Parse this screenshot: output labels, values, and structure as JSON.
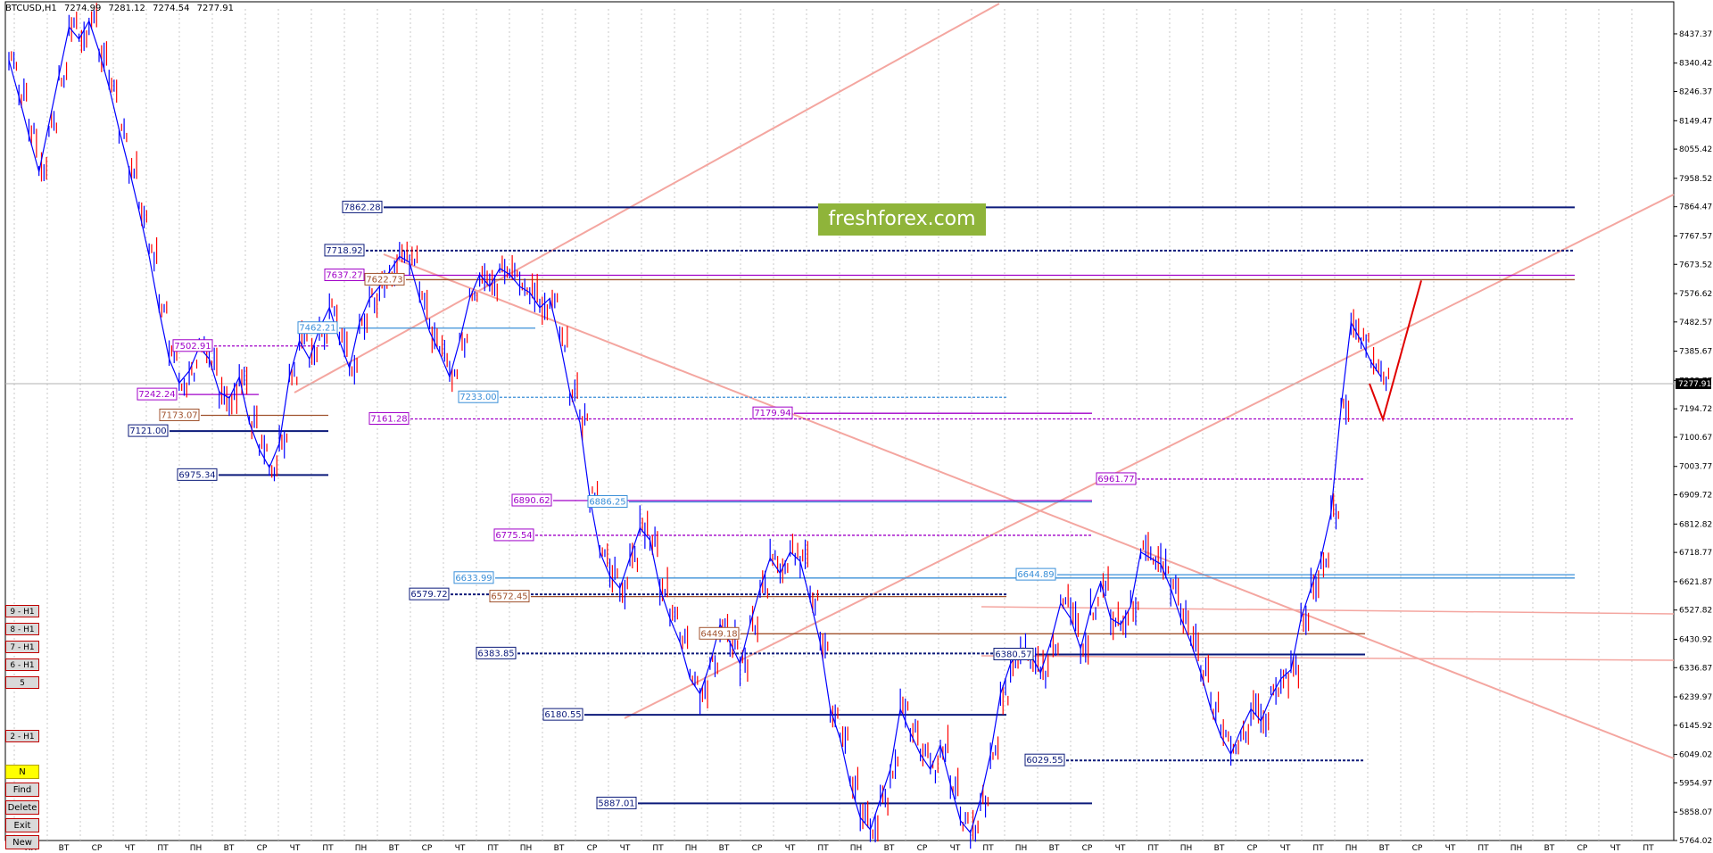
{
  "window": {
    "symbol_title": "BTCUSD,H1",
    "ohlc": [
      "7274.99",
      "7281.12",
      "7274.54",
      "7277.91"
    ],
    "current_price": "7277.91"
  },
  "watermark": "freshforex.com",
  "colors": {
    "candle": "#0000ff",
    "candle_alt": "#ff0000",
    "navy_level": "#0b1a7a",
    "purple_level": "#a000c8",
    "light_blue_level": "#3a8fd8",
    "brown_level": "#a0522d",
    "trend_line": "#f4a6a0",
    "forecast": "#e00000",
    "grid": "#c8c8c8"
  },
  "side_buttons": {
    "b9": "9 - H1",
    "b8": "8 - H1",
    "b7": "7 - H1",
    "b6": "6 - H1",
    "b5": "5",
    "b2": "2 - H1",
    "n": "N",
    "find": "Find",
    "delete": "Delete",
    "exit": "Exit",
    "new": "New"
  },
  "chart_data": {
    "type": "line",
    "symbol": "BTCUSD,H1",
    "ylim": [
      5764.0,
      8520.0
    ],
    "y_ticks": [
      "8437.37",
      "8340.42",
      "8246.37",
      "8149.47",
      "8055.42",
      "7958.52",
      "7864.47",
      "7767.57",
      "7673.52",
      "7576.62",
      "7482.57",
      "7385.67",
      "7288.77",
      "7194.72",
      "7100.67",
      "7003.77",
      "6909.72",
      "6812.82",
      "6718.77",
      "6621.87",
      "6527.82",
      "6430.92",
      "6336.87",
      "6239.97",
      "6145.92",
      "6049.02",
      "5954.97",
      "5858.07",
      "5764.02"
    ],
    "x_day_labels": [
      "ПН",
      "ВТ",
      "СР",
      "ЧТ",
      "ПТ",
      "ПН",
      "ВТ",
      "СР",
      "ЧТ",
      "ПТ",
      "ПН",
      "ВТ",
      "СР",
      "ЧТ",
      "ПТ",
      "ПН",
      "ВТ",
      "СР",
      "ЧТ",
      "ПТ",
      "ПН",
      "ВТ",
      "СР",
      "ЧТ",
      "ПТ",
      "ПН",
      "ВТ",
      "СР",
      "ЧТ",
      "ПТ",
      "ПН",
      "ВТ",
      "СР",
      "ЧТ",
      "ПТ",
      "ПН",
      "ВТ",
      "СР",
      "ЧТ",
      "ПТ",
      "ПН",
      "ВТ",
      "СР",
      "ЧТ",
      "ПТ",
      "ПН",
      "ВТ",
      "СР",
      "ЧТ",
      "ПТ"
    ],
    "price_path": [
      8350,
      8230,
      8100,
      7980,
      8140,
      8300,
      8460,
      8420,
      8480,
      8380,
      8260,
      8120,
      7990,
      7850,
      7700,
      7520,
      7360,
      7280,
      7320,
      7400,
      7360,
      7250,
      7230,
      7300,
      7150,
      7060,
      7000,
      7080,
      7300,
      7420,
      7360,
      7460,
      7530,
      7420,
      7330,
      7480,
      7560,
      7600,
      7650,
      7700,
      7680,
      7560,
      7450,
      7380,
      7300,
      7420,
      7560,
      7640,
      7600,
      7660,
      7640,
      7600,
      7580,
      7530,
      7560,
      7420,
      7250,
      7150,
      6900,
      6720,
      6640,
      6600,
      6700,
      6800,
      6760,
      6600,
      6500,
      6420,
      6300,
      6250,
      6350,
      6480,
      6420,
      6350,
      6480,
      6600,
      6700,
      6650,
      6720,
      6690,
      6560,
      6420,
      6200,
      6100,
      5950,
      5840,
      5800,
      5900,
      6000,
      6200,
      6120,
      6050,
      6000,
      6080,
      5950,
      5830,
      5790,
      5900,
      6050,
      6250,
      6350,
      6400,
      6380,
      6320,
      6420,
      6550,
      6500,
      6400,
      6530,
      6620,
      6500,
      6480,
      6540,
      6720,
      6700,
      6680,
      6600,
      6500,
      6420,
      6320,
      6200,
      6110,
      6050,
      6130,
      6200,
      6160,
      6240,
      6300,
      6330,
      6500,
      6600,
      6700,
      6850,
      7200,
      7480,
      7420,
      7350,
      7300
    ],
    "levels": [
      {
        "label": "7862.28",
        "price": 7862.28,
        "color": "navy"
      },
      {
        "label": "7718.92",
        "price": 7718.92,
        "color": "navy"
      },
      {
        "label": "7637.27",
        "price": 7637.27,
        "color": "purple"
      },
      {
        "label": "7622.73",
        "price": 7622.73,
        "color": "brown"
      },
      {
        "label": "7502.91",
        "price": 7402.91,
        "color": "purple"
      },
      {
        "label": "7462.21",
        "price": 7462.21,
        "color": "light_blue"
      },
      {
        "label": "7242.24",
        "price": 7242.24,
        "color": "purple"
      },
      {
        "label": "7233.00",
        "price": 7233.0,
        "color": "light_blue"
      },
      {
        "label": "7179.94",
        "price": 7179.94,
        "color": "purple"
      },
      {
        "label": "7173.07",
        "price": 7173.07,
        "color": "brown"
      },
      {
        "label": "7161.28",
        "price": 7161.28,
        "color": "purple"
      },
      {
        "label": "7121.00",
        "price": 7121.0,
        "color": "navy"
      },
      {
        "label": "6975.34",
        "price": 6975.34,
        "color": "navy"
      },
      {
        "label": "6961.77",
        "price": 6961.77,
        "color": "purple"
      },
      {
        "label": "6890.62",
        "price": 6890.62,
        "color": "purple"
      },
      {
        "label": "6886.25",
        "price": 6886.25,
        "color": "light_blue"
      },
      {
        "label": "6775.54",
        "price": 6775.54,
        "color": "purple"
      },
      {
        "label": "6644.89",
        "price": 6644.89,
        "color": "light_blue"
      },
      {
        "label": "6633.99",
        "price": 6633.99,
        "color": "light_blue"
      },
      {
        "label": "6579.72",
        "price": 6579.72,
        "color": "navy"
      },
      {
        "label": "6572.45",
        "price": 6572.45,
        "color": "brown"
      },
      {
        "label": "6449.18",
        "price": 6449.18,
        "color": "brown"
      },
      {
        "label": "6383.85",
        "price": 6383.85,
        "color": "navy"
      },
      {
        "label": "6380.57",
        "price": 6380.57,
        "color": "navy"
      },
      {
        "label": "6180.55",
        "price": 6180.55,
        "color": "navy"
      },
      {
        "label": "6029.55",
        "price": 6029.55,
        "color": "navy"
      },
      {
        "label": "5887.01",
        "price": 5887.01,
        "color": "navy"
      }
    ],
    "forecast_path": [
      7277.91,
      7160.0,
      7620.0
    ],
    "grid": true
  }
}
